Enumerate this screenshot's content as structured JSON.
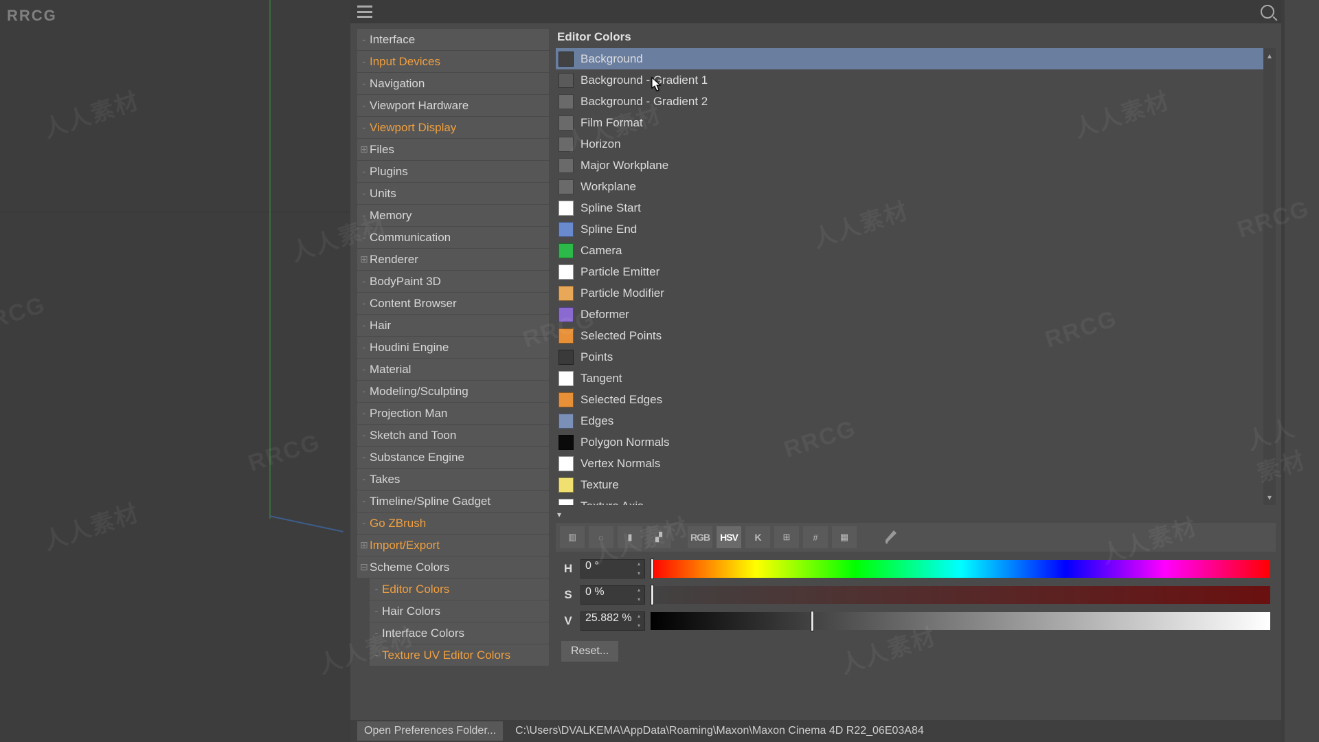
{
  "tree": [
    {
      "label": "Interface",
      "ind": 0,
      "tw": "-",
      "hl": false
    },
    {
      "label": "Input Devices",
      "ind": 0,
      "tw": "-",
      "hl": true
    },
    {
      "label": "Navigation",
      "ind": 0,
      "tw": "-",
      "hl": false
    },
    {
      "label": "Viewport Hardware",
      "ind": 0,
      "tw": "-",
      "hl": false
    },
    {
      "label": "Viewport Display",
      "ind": 0,
      "tw": "-",
      "hl": true
    },
    {
      "label": "Files",
      "ind": 0,
      "tw": "⊞",
      "hl": false
    },
    {
      "label": "Plugins",
      "ind": 0,
      "tw": "-",
      "hl": false
    },
    {
      "label": "Units",
      "ind": 0,
      "tw": "-",
      "hl": false
    },
    {
      "label": "Memory",
      "ind": 0,
      "tw": "-",
      "hl": false
    },
    {
      "label": "Communication",
      "ind": 0,
      "tw": "-",
      "hl": false
    },
    {
      "label": "Renderer",
      "ind": 0,
      "tw": "⊞",
      "hl": false
    },
    {
      "label": "BodyPaint 3D",
      "ind": 0,
      "tw": "-",
      "hl": false
    },
    {
      "label": "Content Browser",
      "ind": 0,
      "tw": "-",
      "hl": false
    },
    {
      "label": "Hair",
      "ind": 0,
      "tw": "-",
      "hl": false
    },
    {
      "label": "Houdini Engine",
      "ind": 0,
      "tw": "-",
      "hl": false
    },
    {
      "label": "Material",
      "ind": 0,
      "tw": "-",
      "hl": false
    },
    {
      "label": "Modeling/Sculpting",
      "ind": 0,
      "tw": "-",
      "hl": false
    },
    {
      "label": "Projection Man",
      "ind": 0,
      "tw": "-",
      "hl": false
    },
    {
      "label": "Sketch and Toon",
      "ind": 0,
      "tw": "-",
      "hl": false
    },
    {
      "label": "Substance Engine",
      "ind": 0,
      "tw": "-",
      "hl": false
    },
    {
      "label": "Takes",
      "ind": 0,
      "tw": "-",
      "hl": false
    },
    {
      "label": "Timeline/Spline Gadget",
      "ind": 0,
      "tw": "-",
      "hl": false
    },
    {
      "label": "Go ZBrush",
      "ind": 0,
      "tw": "-",
      "hl": true
    },
    {
      "label": "Import/Export",
      "ind": 0,
      "tw": "⊞",
      "hl": true
    },
    {
      "label": "Scheme Colors",
      "ind": 0,
      "tw": "⊟",
      "hl": false
    },
    {
      "label": "Editor Colors",
      "ind": 1,
      "tw": "-",
      "hl": true,
      "sel": true
    },
    {
      "label": "Hair Colors",
      "ind": 1,
      "tw": "-",
      "hl": false
    },
    {
      "label": "Interface Colors",
      "ind": 1,
      "tw": "-",
      "hl": false
    },
    {
      "label": "Texture UV Editor Colors",
      "ind": 1,
      "tw": "-",
      "hl": true
    }
  ],
  "section_title": "Editor Colors",
  "color_items": [
    {
      "label": "Background",
      "color": "#424242",
      "selected": true
    },
    {
      "label": "Background - Gradient 1",
      "color": "#5a5a5a"
    },
    {
      "label": "Background - Gradient 2",
      "color": "#6a6a6a"
    },
    {
      "label": "Film Format",
      "color": "#6a6a6a"
    },
    {
      "label": "Horizon",
      "color": "#6a6a6a"
    },
    {
      "label": "Major Workplane",
      "color": "#6a6a6a"
    },
    {
      "label": "Workplane",
      "color": "#6a6a6a"
    },
    {
      "label": "Spline Start",
      "color": "#ffffff"
    },
    {
      "label": "Spline End",
      "color": "#6a8ad0"
    },
    {
      "label": "Camera",
      "color": "#2db84a"
    },
    {
      "label": "Particle Emitter",
      "color": "#ffffff"
    },
    {
      "label": "Particle Modifier",
      "color": "#e8a858"
    },
    {
      "label": "Deformer",
      "color": "#8a6ad0"
    },
    {
      "label": "Selected Points",
      "color": "#e89038"
    },
    {
      "label": "Points",
      "color": "#3a3a3a"
    },
    {
      "label": "Tangent",
      "color": "#ffffff"
    },
    {
      "label": "Selected Edges",
      "color": "#e89038"
    },
    {
      "label": "Edges",
      "color": "#7a90b8"
    },
    {
      "label": "Polygon Normals",
      "color": "#0a0a0a"
    },
    {
      "label": "Vertex Normals",
      "color": "#ffffff"
    },
    {
      "label": "Texture",
      "color": "#f0e070"
    },
    {
      "label": "Texture Axis",
      "color": "#ffffff"
    }
  ],
  "toolbar_modes": [
    "RGB",
    "HSV",
    "K"
  ],
  "toolbar_active": "HSV",
  "hsv": {
    "h": {
      "label": "H",
      "value": "0 °",
      "thumb": 0
    },
    "s": {
      "label": "S",
      "value": "0 %",
      "thumb": 0
    },
    "v": {
      "label": "V",
      "value": "25.882 %",
      "thumb": 25.882
    }
  },
  "reset_label": "Reset...",
  "footer": {
    "open_btn": "Open Preferences Folder...",
    "path": "C:\\Users\\DVALKEMA\\AppData\\Roaming\\Maxon\\Maxon Cinema 4D R22_06E03A84"
  },
  "watermark_cn": "人人素材",
  "watermark_en": "RRCG"
}
